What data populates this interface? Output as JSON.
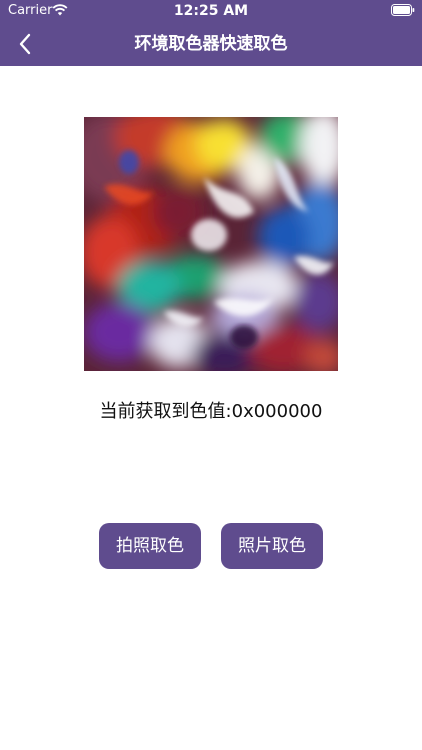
{
  "status_bar": {
    "carrier": "Carrier",
    "time": "12:25 AM"
  },
  "nav": {
    "title": "环境取色器快速取色",
    "back_icon": "chevron-left-icon"
  },
  "picked_color": {
    "label": "当前获取到色值:0x000000"
  },
  "actions": {
    "camera_pick": "拍照取色",
    "photo_pick": "照片取色"
  },
  "colors": {
    "header": "#5f4c8e",
    "button": "#5f4c8e",
    "background": "#ffffff"
  }
}
